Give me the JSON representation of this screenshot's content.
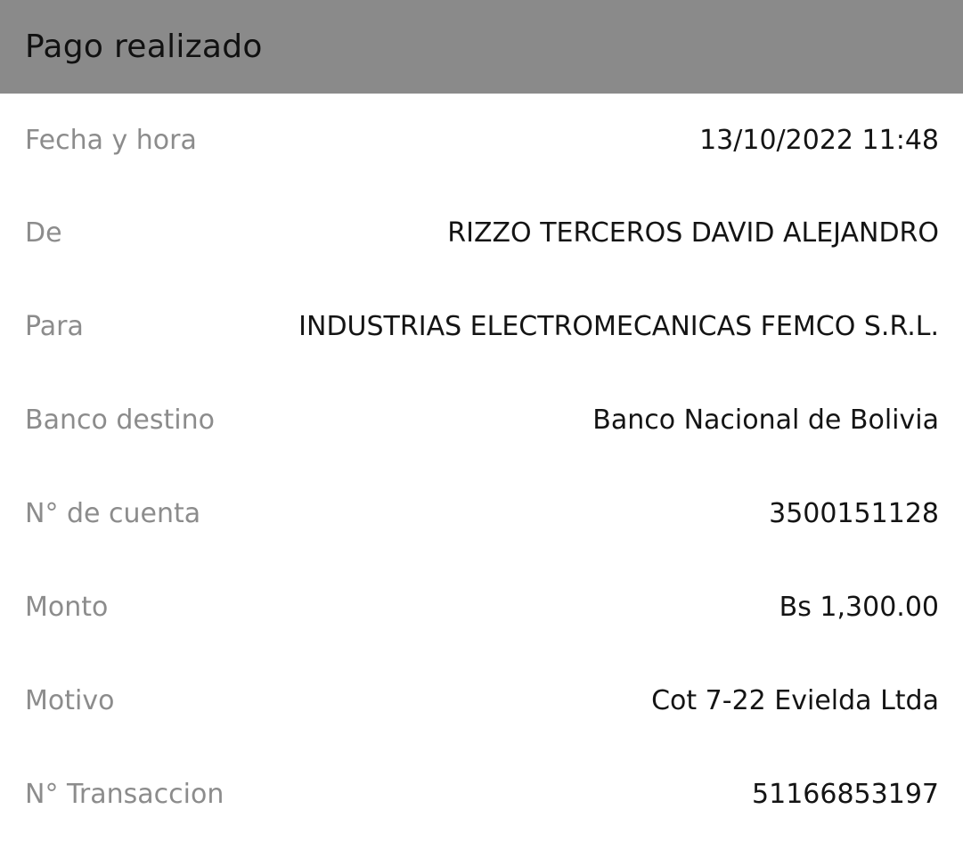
{
  "header": {
    "title": "Pago realizado"
  },
  "details": [
    {
      "label": "Fecha y hora",
      "value": "13/10/2022 11:48"
    },
    {
      "label": "De",
      "value": "RIZZO TERCEROS DAVID ALEJANDRO"
    },
    {
      "label": "Para",
      "value": "INDUSTRIAS ELECTROMECANICAS FEMCO S.R.L."
    },
    {
      "label": "Banco destino",
      "value": "Banco Nacional de Bolivia"
    },
    {
      "label": "N° de cuenta",
      "value": "3500151128"
    },
    {
      "label": "Monto",
      "value": "Bs 1,300.00"
    },
    {
      "label": "Motivo",
      "value": "Cot 7-22 Evielda Ltda"
    },
    {
      "label": "N° Transaccion",
      "value": "51166853197"
    }
  ],
  "colors": {
    "header_bg": "#8a8a8a",
    "label_text": "#8c8c8c",
    "value_text": "#141414"
  }
}
